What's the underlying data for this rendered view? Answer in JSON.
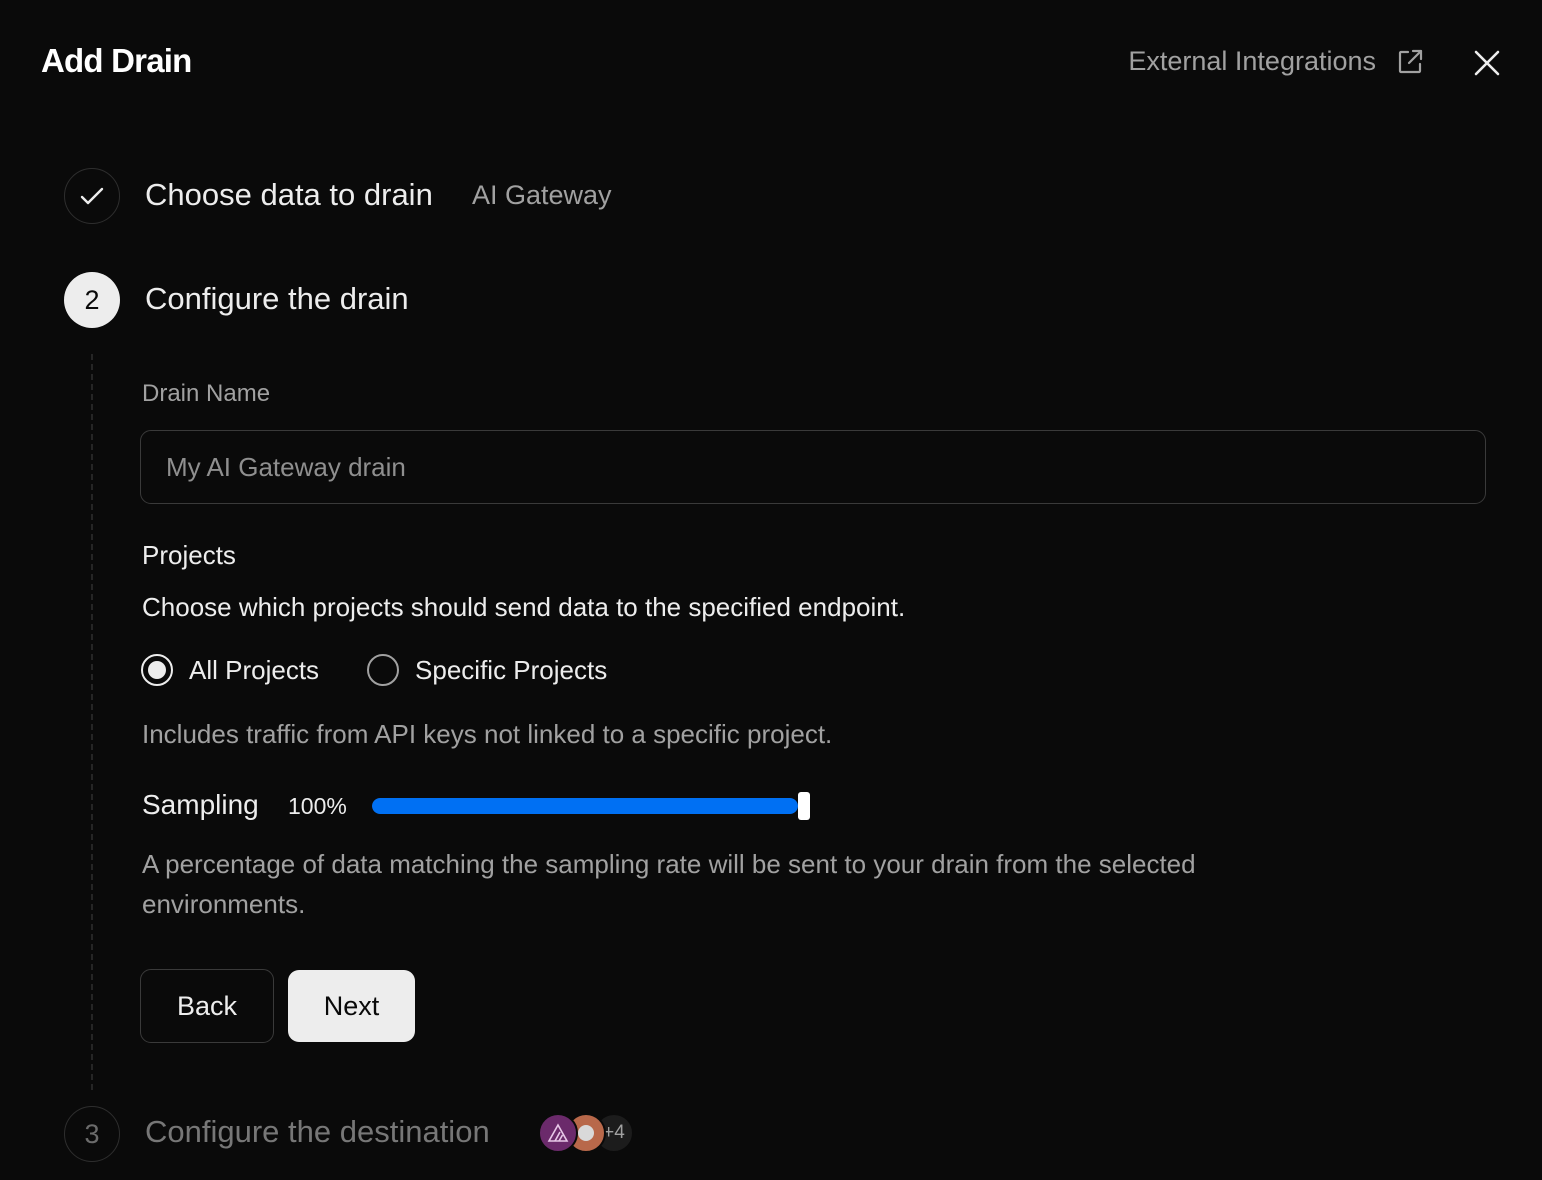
{
  "header": {
    "title": "Add Drain",
    "external_link_label": "External Integrations",
    "external_icon": "external-link-icon",
    "close_icon": "close-icon"
  },
  "steps": [
    {
      "number": "1",
      "state": "done",
      "icon": "check-icon",
      "title": "Choose data to drain",
      "subtitle": "AI Gateway"
    },
    {
      "number": "2",
      "state": "active",
      "title": "Configure the drain"
    },
    {
      "number": "3",
      "state": "pending",
      "title": "Configure the destination",
      "avatar_overflow": "+4"
    }
  ],
  "form": {
    "drain_name_label": "Drain Name",
    "drain_name_placeholder": "My AI Gateway drain",
    "drain_name_value": "",
    "projects_title": "Projects",
    "projects_description": "Choose which projects should send data to the specified endpoint.",
    "project_options": [
      "All Projects",
      "Specific Projects"
    ],
    "selected_project_option": "All Projects",
    "projects_hint": "Includes traffic from API keys not linked to a specific project.",
    "sampling_label": "Sampling",
    "sampling_value_label": "100%",
    "sampling_value": 100,
    "sampling_description": "A percentage of data matching the sampling rate will be sent to your drain from the selected environments."
  },
  "buttons": {
    "back": "Back",
    "next": "Next"
  },
  "colors": {
    "background": "#0a0a0a",
    "accent": "#0070f3",
    "primary_button": "#ededed"
  }
}
